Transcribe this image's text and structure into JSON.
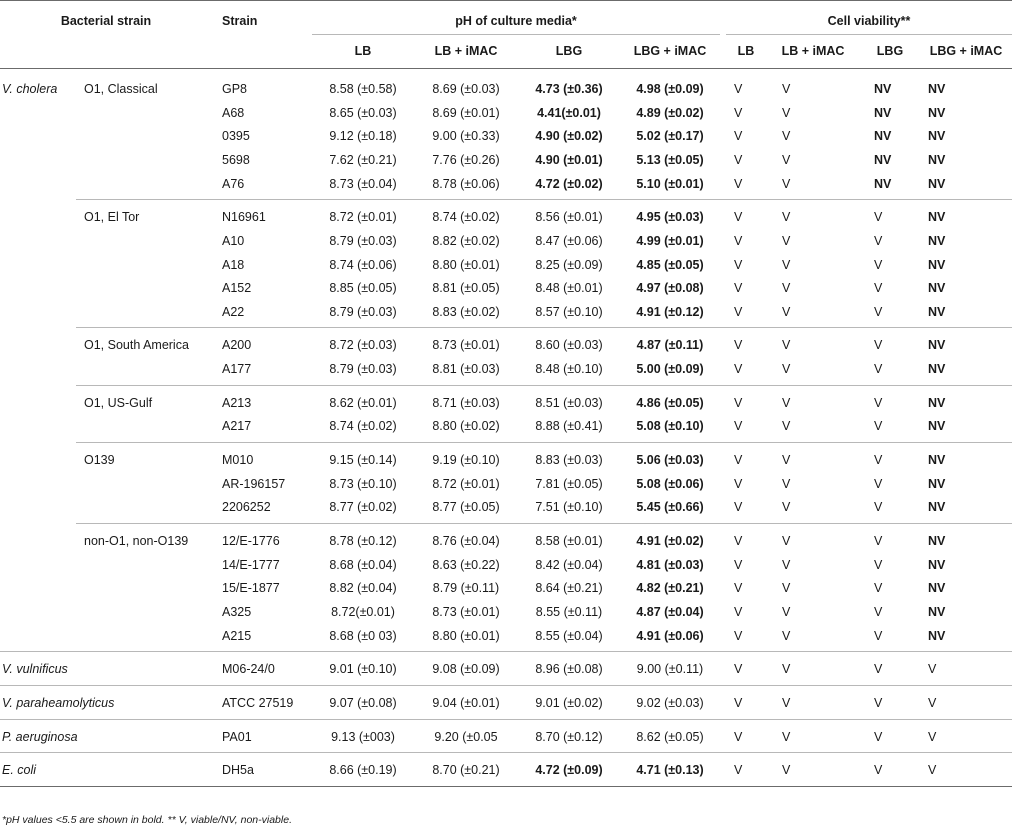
{
  "table": {
    "headers": {
      "bacterial_strain": "Bacterial strain",
      "strain": "Strain",
      "ph_group": "pH of culture media*",
      "viability_group": "Cell viability**",
      "ph_sub": [
        "LB",
        "LB + iMAC",
        "LBG",
        "LBG + iMAC"
      ],
      "via_sub": [
        "LB",
        "LB + iMAC",
        "LBG",
        "LBG + iMAC"
      ]
    },
    "sections": [
      {
        "species": "V. cholera",
        "groups": [
          {
            "name": "O1, Classical",
            "rows": [
              {
                "strain": "GP8",
                "ph": [
                  "8.58 (±0.58)",
                  "8.69 (±0.03)",
                  "4.73 (±0.36)",
                  "4.98 (±0.09)"
                ],
                "ph_bold": [
                  false,
                  false,
                  true,
                  true
                ],
                "via": [
                  "V",
                  "V",
                  "NV",
                  "NV"
                ]
              },
              {
                "strain": "A68",
                "ph": [
                  "8.65 (±0.03)",
                  "8.69 (±0.01)",
                  "4.41(±0.01)",
                  "4.89 (±0.02)"
                ],
                "ph_bold": [
                  false,
                  false,
                  true,
                  true
                ],
                "via": [
                  "V",
                  "V",
                  "NV",
                  "NV"
                ]
              },
              {
                "strain": "0395",
                "ph": [
                  "9.12 (±0.18)",
                  "9.00 (±0.33)",
                  "4.90 (±0.02)",
                  "5.02 (±0.17)"
                ],
                "ph_bold": [
                  false,
                  false,
                  true,
                  true
                ],
                "via": [
                  "V",
                  "V",
                  "NV",
                  "NV"
                ]
              },
              {
                "strain": "5698",
                "ph": [
                  "7.62 (±0.21)",
                  "7.76 (±0.26)",
                  "4.90 (±0.01)",
                  "5.13 (±0.05)"
                ],
                "ph_bold": [
                  false,
                  false,
                  true,
                  true
                ],
                "via": [
                  "V",
                  "V",
                  "NV",
                  "NV"
                ]
              },
              {
                "strain": "A76",
                "ph": [
                  "8.73 (±0.04)",
                  "8.78 (±0.06)",
                  "4.72 (±0.02)",
                  "5.10 (±0.01)"
                ],
                "ph_bold": [
                  false,
                  false,
                  true,
                  true
                ],
                "via": [
                  "V",
                  "V",
                  "NV",
                  "NV"
                ]
              }
            ]
          },
          {
            "name": "O1, El Tor",
            "rows": [
              {
                "strain": "N16961",
                "ph": [
                  "8.72 (±0.01)",
                  "8.74 (±0.02)",
                  "8.56 (±0.01)",
                  "4.95 (±0.03)"
                ],
                "ph_bold": [
                  false,
                  false,
                  false,
                  true
                ],
                "via": [
                  "V",
                  "V",
                  "V",
                  "NV"
                ]
              },
              {
                "strain": "A10",
                "ph": [
                  "8.79 (±0.03)",
                  "8.82 (±0.02)",
                  "8.47 (±0.06)",
                  "4.99 (±0.01)"
                ],
                "ph_bold": [
                  false,
                  false,
                  false,
                  true
                ],
                "via": [
                  "V",
                  "V",
                  "V",
                  "NV"
                ]
              },
              {
                "strain": "A18",
                "ph": [
                  "8.74 (±0.06)",
                  "8.80 (±0.01)",
                  "8.25 (±0.09)",
                  "4.85 (±0.05)"
                ],
                "ph_bold": [
                  false,
                  false,
                  false,
                  true
                ],
                "via": [
                  "V",
                  "V",
                  "V",
                  "NV"
                ]
              },
              {
                "strain": "A152",
                "ph": [
                  "8.85 (±0.05)",
                  "8.81 (±0.05)",
                  "8.48 (±0.01)",
                  "4.97 (±0.08)"
                ],
                "ph_bold": [
                  false,
                  false,
                  false,
                  true
                ],
                "via": [
                  "V",
                  "V",
                  "V",
                  "NV"
                ]
              },
              {
                "strain": "A22",
                "ph": [
                  "8.79 (±0.03)",
                  "8.83 (±0.02)",
                  "8.57 (±0.10)",
                  "4.91 (±0.12)"
                ],
                "ph_bold": [
                  false,
                  false,
                  false,
                  true
                ],
                "via": [
                  "V",
                  "V",
                  "V",
                  "NV"
                ]
              }
            ]
          },
          {
            "name": "O1, South America",
            "rows": [
              {
                "strain": "A200",
                "ph": [
                  "8.72 (±0.03)",
                  "8.73 (±0.01)",
                  "8.60 (±0.03)",
                  "4.87 (±0.11)"
                ],
                "ph_bold": [
                  false,
                  false,
                  false,
                  true
                ],
                "via": [
                  "V",
                  "V",
                  "V",
                  "NV"
                ]
              },
              {
                "strain": "A177",
                "ph": [
                  "8.79 (±0.03)",
                  "8.81 (±0.03)",
                  "8.48 (±0.10)",
                  "5.00 (±0.09)"
                ],
                "ph_bold": [
                  false,
                  false,
                  false,
                  true
                ],
                "via": [
                  "V",
                  "V",
                  "V",
                  "NV"
                ]
              }
            ]
          },
          {
            "name": "O1, US-Gulf",
            "rows": [
              {
                "strain": "A213",
                "ph": [
                  "8.62 (±0.01)",
                  "8.71 (±0.03)",
                  "8.51 (±0.03)",
                  "4.86 (±0.05)"
                ],
                "ph_bold": [
                  false,
                  false,
                  false,
                  true
                ],
                "via": [
                  "V",
                  "V",
                  "V",
                  "NV"
                ]
              },
              {
                "strain": "A217",
                "ph": [
                  "8.74 (±0.02)",
                  "8.80 (±0.02)",
                  "8.88 (±0.41)",
                  "5.08 (±0.10)"
                ],
                "ph_bold": [
                  false,
                  false,
                  false,
                  true
                ],
                "via": [
                  "V",
                  "V",
                  "V",
                  "NV"
                ]
              }
            ]
          },
          {
            "name": "O139",
            "rows": [
              {
                "strain": "M010",
                "ph": [
                  "9.15 (±0.14)",
                  "9.19 (±0.10)",
                  "8.83 (±0.03)",
                  "5.06 (±0.03)"
                ],
                "ph_bold": [
                  false,
                  false,
                  false,
                  true
                ],
                "via": [
                  "V",
                  "V",
                  "V",
                  "NV"
                ]
              },
              {
                "strain": "AR-196157",
                "ph": [
                  "8.73 (±0.10)",
                  "8.72 (±0.01)",
                  "7.81 (±0.05)",
                  "5.08 (±0.06)"
                ],
                "ph_bold": [
                  false,
                  false,
                  false,
                  true
                ],
                "via": [
                  "V",
                  "V",
                  "V",
                  "NV"
                ]
              },
              {
                "strain": "2206252",
                "ph": [
                  "8.77 (±0.02)",
                  "8.77 (±0.05)",
                  "7.51 (±0.10)",
                  "5.45 (±0.66)"
                ],
                "ph_bold": [
                  false,
                  false,
                  false,
                  true
                ],
                "via": [
                  "V",
                  "V",
                  "V",
                  "NV"
                ]
              }
            ]
          },
          {
            "name": "non-O1, non-O139",
            "rows": [
              {
                "strain": "12/E-1776",
                "ph": [
                  "8.78 (±0.12)",
                  "8.76 (±0.04)",
                  "8.58 (±0.01)",
                  "4.91 (±0.02)"
                ],
                "ph_bold": [
                  false,
                  false,
                  false,
                  true
                ],
                "via": [
                  "V",
                  "V",
                  "V",
                  "NV"
                ]
              },
              {
                "strain": "14/E-1777",
                "ph": [
                  "8.68 (±0.04)",
                  "8.63 (±0.22)",
                  "8.42 (±0.04)",
                  "4.81 (±0.03)"
                ],
                "ph_bold": [
                  false,
                  false,
                  false,
                  true
                ],
                "via": [
                  "V",
                  "V",
                  "V",
                  "NV"
                ]
              },
              {
                "strain": "15/E-1877",
                "ph": [
                  "8.82 (±0.04)",
                  "8.79 (±0.11)",
                  "8.64 (±0.21)",
                  "4.82 (±0.21)"
                ],
                "ph_bold": [
                  false,
                  false,
                  false,
                  true
                ],
                "via": [
                  "V",
                  "V",
                  "V",
                  "NV"
                ]
              },
              {
                "strain": "A325",
                "ph": [
                  "8.72(±0.01)",
                  "8.73 (±0.01)",
                  "8.55 (±0.11)",
                  "4.87 (±0.04)"
                ],
                "ph_bold": [
                  false,
                  false,
                  false,
                  true
                ],
                "via": [
                  "V",
                  "V",
                  "V",
                  "NV"
                ]
              },
              {
                "strain": "A215",
                "ph": [
                  "8.68 (±0 03)",
                  "8.80 (±0.01)",
                  "8.55 (±0.04)",
                  "4.91 (±0.06)"
                ],
                "ph_bold": [
                  false,
                  false,
                  false,
                  true
                ],
                "via": [
                  "V",
                  "V",
                  "V",
                  "NV"
                ]
              }
            ]
          }
        ]
      },
      {
        "species": "V. vulnificus",
        "groups": [
          {
            "name": "",
            "rows": [
              {
                "strain": "M06-24/0",
                "ph": [
                  "9.01 (±0.10)",
                  "9.08 (±0.09)",
                  "8.96 (±0.08)",
                  "9.00 (±0.11)"
                ],
                "ph_bold": [
                  false,
                  false,
                  false,
                  false
                ],
                "via": [
                  "V",
                  "V",
                  "V",
                  "V"
                ]
              }
            ]
          }
        ]
      },
      {
        "species": "V. paraheamolyticus",
        "groups": [
          {
            "name": "",
            "rows": [
              {
                "strain": "ATCC 27519",
                "ph": [
                  "9.07 (±0.08)",
                  "9.04 (±0.01)",
                  "9.01 (±0.02)",
                  "9.02 (±0.03)"
                ],
                "ph_bold": [
                  false,
                  false,
                  false,
                  false
                ],
                "via": [
                  "V",
                  "V",
                  "V",
                  "V"
                ]
              }
            ]
          }
        ]
      },
      {
        "species": "P. aeruginosa",
        "groups": [
          {
            "name": "",
            "rows": [
              {
                "strain": "PA01",
                "ph": [
                  "9.13 (±003)",
                  "9.20 (±0.05",
                  "8.70 (±0.12)",
                  "8.62 (±0.05)"
                ],
                "ph_bold": [
                  false,
                  false,
                  false,
                  false
                ],
                "via": [
                  "V",
                  "V",
                  "V",
                  "V"
                ]
              }
            ]
          }
        ]
      },
      {
        "species": "E. coli",
        "groups": [
          {
            "name": "",
            "rows": [
              {
                "strain": "DH5a",
                "ph": [
                  "8.66 (±0.19)",
                  "8.70 (±0.21)",
                  "4.72 (±0.09)",
                  "4.71 (±0.13)"
                ],
                "ph_bold": [
                  false,
                  false,
                  true,
                  true
                ],
                "via": [
                  "V",
                  "V",
                  "V",
                  "V"
                ]
              }
            ]
          }
        ]
      }
    ],
    "footnote": "*pH values <5.5 are shown in bold. ** V, viable/NV, non-viable."
  }
}
